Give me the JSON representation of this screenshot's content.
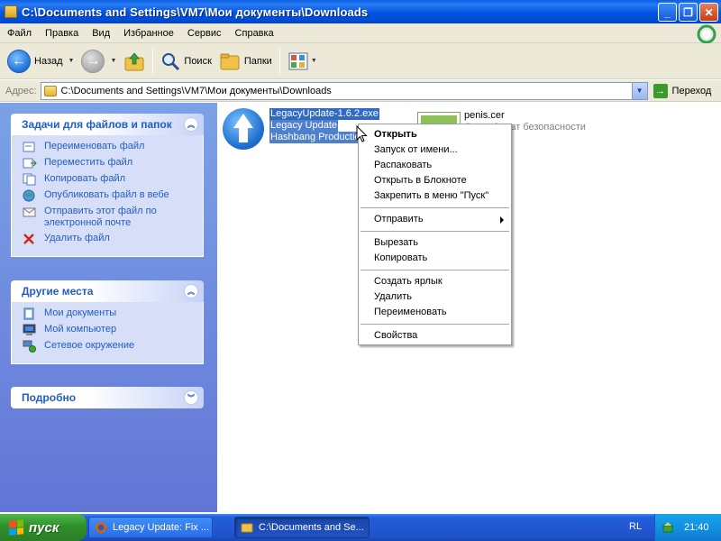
{
  "window": {
    "title": "C:\\Documents and Settings\\VM7\\Мои документы\\Downloads",
    "controls": [
      "minimize",
      "maximize",
      "close"
    ]
  },
  "menu": [
    "Файл",
    "Правка",
    "Вид",
    "Избранное",
    "Сервис",
    "Справка"
  ],
  "toolbar": {
    "back": "Назад",
    "search": "Поиск",
    "folders": "Папки"
  },
  "address": {
    "label": "Адрес:",
    "value": "C:\\Documents and Settings\\VM7\\Мои документы\\Downloads",
    "go": "Переход"
  },
  "left_pane": {
    "tasks": {
      "title": "Задачи для файлов и папок",
      "items": [
        {
          "label": "Переименовать файл",
          "icon": "rename-icon"
        },
        {
          "label": "Переместить файл",
          "icon": "move-icon"
        },
        {
          "label": "Копировать файл",
          "icon": "copy-icon"
        },
        {
          "label": "Опубликовать файл в вебе",
          "icon": "publish-web-icon"
        },
        {
          "label": "Отправить этот файл по электронной почте",
          "icon": "email-icon"
        },
        {
          "label": "Удалить файл",
          "icon": "delete-icon"
        }
      ]
    },
    "places": {
      "title": "Другие места",
      "items": [
        {
          "label": "Мои документы",
          "icon": "my-documents-icon"
        },
        {
          "label": "Мой компьютер",
          "icon": "my-computer-icon"
        },
        {
          "label": "Сетевое окружение",
          "icon": "network-icon"
        }
      ]
    },
    "details": {
      "title": "Подробно"
    }
  },
  "files": [
    {
      "name": "LegacyUpdate-1.6.2.exe",
      "line2": "Legacy Update",
      "line3": "Hashbang Productions",
      "icon": "legacy-update-icon",
      "selected": true
    },
    {
      "name": "penis.cer",
      "line2": "Сертификат безопасности",
      "icon": "certificate-icon",
      "selected": false
    }
  ],
  "context_menu": [
    {
      "label": "Открыть",
      "bold": true
    },
    {
      "label": "Запуск от имени..."
    },
    {
      "label": "Распаковать"
    },
    {
      "label": "Открыть в Блокноте"
    },
    {
      "label": "Закрепить в меню \"Пуск\""
    },
    {
      "sep": true
    },
    {
      "label": "Отправить",
      "submenu": true
    },
    {
      "sep": true
    },
    {
      "label": "Вырезать"
    },
    {
      "label": "Копировать"
    },
    {
      "sep": true
    },
    {
      "label": "Создать ярлык"
    },
    {
      "label": "Удалить"
    },
    {
      "label": "Переименовать"
    },
    {
      "sep": true
    },
    {
      "label": "Свойства"
    }
  ],
  "taskbar": {
    "start": "пуск",
    "tasks": [
      {
        "label": "Legacy Update: Fix ...",
        "icon": "firefox-icon",
        "active": false
      },
      {
        "label": "C:\\Documents and Se...",
        "icon": "folder-icon",
        "active": true
      }
    ],
    "language": "RL",
    "clock": "21:40"
  },
  "colors": {
    "titlebar": "#0054e3",
    "left_pane": "#6f8fe0",
    "link": "#215dc6",
    "selection": "#316ac5",
    "start": "#2f8f2a"
  }
}
